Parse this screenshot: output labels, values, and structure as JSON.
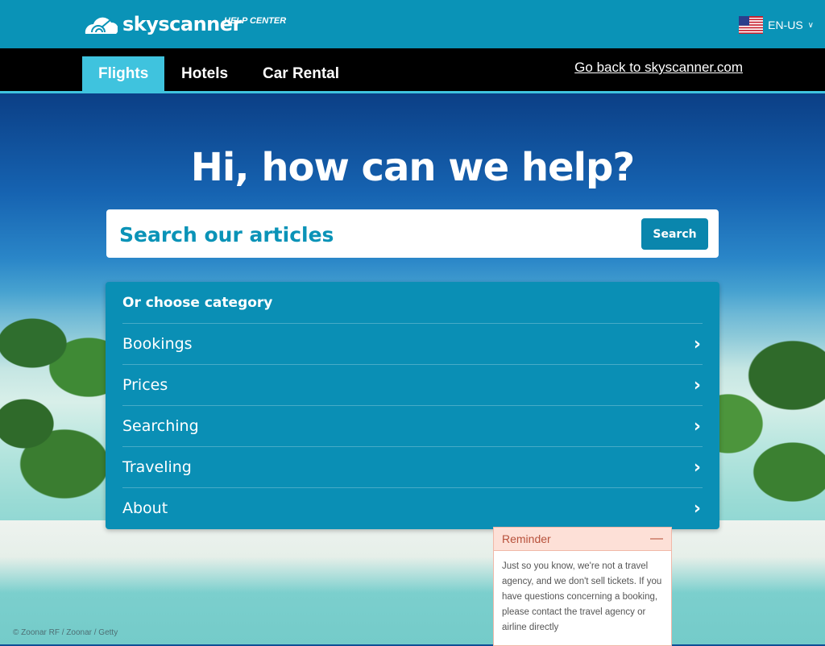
{
  "header": {
    "brand": "skyscanner",
    "subtitle": "HELP CENTER",
    "language": "EN-US"
  },
  "nav": {
    "tabs": [
      {
        "label": "Flights",
        "active": true
      },
      {
        "label": "Hotels",
        "active": false
      },
      {
        "label": "Car Rental",
        "active": false
      }
    ],
    "back_link": "Go back to skyscanner.com"
  },
  "hero": {
    "title": "Hi, how can we help?"
  },
  "search": {
    "placeholder": "Search our articles",
    "button_label": "Search"
  },
  "categories": {
    "heading": "Or choose category",
    "items": [
      "Bookings",
      "Prices",
      "Searching",
      "Traveling",
      "About"
    ]
  },
  "reminder": {
    "title": "Reminder",
    "body": "Just so you know, we're not a travel agency, and we don't sell tickets. If you have questions concerning a booking, please contact the travel agency or airline directly"
  },
  "credit": "© Zoonar RF / Zoonar / Getty",
  "colors": {
    "brand": "#0a93b7",
    "nav_active": "#3fc3de",
    "panel": "#0a8fb5",
    "reminder_header": "#fde0d7"
  }
}
